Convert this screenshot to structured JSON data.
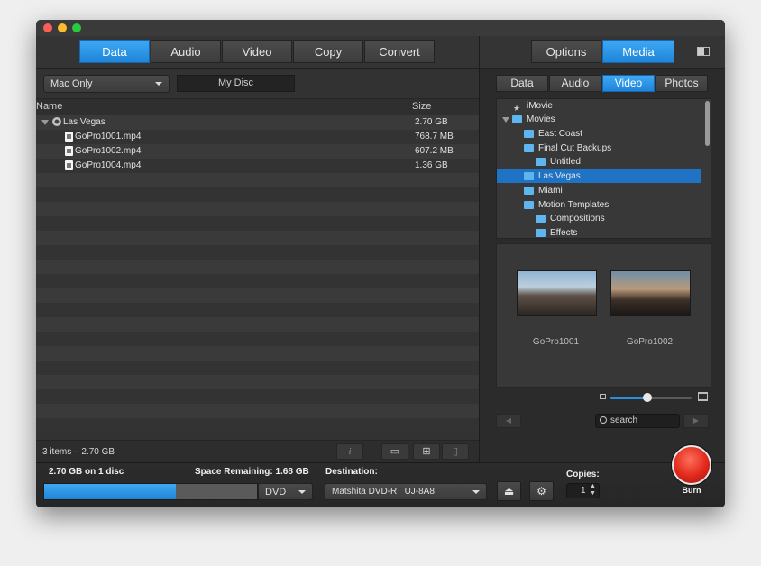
{
  "toolbar": {
    "tabs_left": [
      "Data",
      "Audio",
      "Video",
      "Copy",
      "Convert"
    ],
    "active_left": "Data",
    "tabs_right": [
      "Options",
      "Media"
    ],
    "active_right": "Media"
  },
  "left": {
    "filter_select": "Mac Only",
    "disc_name": "My Disc",
    "columns": {
      "name": "Name",
      "size": "Size"
    },
    "root": {
      "name": "Las Vegas",
      "size": "2.70 GB"
    },
    "files": [
      {
        "name": "GoPro1001.mp4",
        "size": "768.7 MB"
      },
      {
        "name": "GoPro1002.mp4",
        "size": "607.2 MB"
      },
      {
        "name": "GoPro1004.mp4",
        "size": "1.36 GB"
      }
    ],
    "status": "3 items – 2.70 GB",
    "footer_icons": [
      "info-icon",
      "new-folder-icon",
      "add-file-icon",
      "remove-icon"
    ]
  },
  "media": {
    "tabs": [
      "Data",
      "Audio",
      "Video",
      "Photos"
    ],
    "active_tab": "Video",
    "tree": [
      {
        "label": "iMovie"
      },
      {
        "label": "Movies"
      },
      {
        "label": "East Coast"
      },
      {
        "label": "Final Cut Backups"
      },
      {
        "label": "Untitled"
      },
      {
        "label": "Las Vegas"
      },
      {
        "label": "Miami"
      },
      {
        "label": "Motion Templates"
      },
      {
        "label": "Compositions"
      },
      {
        "label": "Effects"
      }
    ],
    "selected": "Las Vegas",
    "thumbs": [
      "GoPro1001",
      "GoPro1002"
    ],
    "zoom_level": 0.45,
    "search_placeholder": "search"
  },
  "bottom": {
    "capacity": "2.70 GB on 1 disc",
    "remaining": "Space Remaining: 1.68 GB",
    "progress": 0.62,
    "disc_type": "DVD",
    "destination_label": "Destination:",
    "destination": "Matshita DVD-R   UJ-8A8",
    "copies_label": "Copies:",
    "copies": "1",
    "burn": "Burn"
  },
  "colors": {
    "accent": "#2a8ee0",
    "selection": "#1e73c4",
    "burn": "#e0281b"
  }
}
